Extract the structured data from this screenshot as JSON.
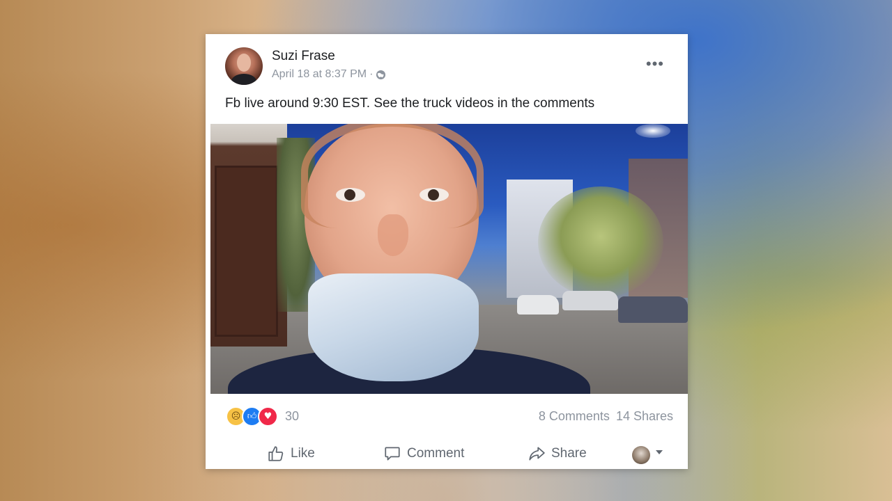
{
  "post": {
    "author": "Suzi Frase",
    "timestamp": "April 18 at 8:37 PM",
    "separator": "·",
    "privacy_icon": "globe-icon",
    "text": "Fb live around 9:30 EST. See the truck videos in the comments",
    "more_label": "•••"
  },
  "stats": {
    "reaction_icons": [
      "sad-reaction-icon",
      "like-reaction-icon",
      "love-reaction-icon"
    ],
    "reaction_count": "30",
    "comments": "8 Comments",
    "shares": "14 Shares"
  },
  "actions": {
    "like": "Like",
    "comment": "Comment",
    "share": "Share"
  },
  "colors": {
    "like_blue": "#1d7cf2",
    "love_red": "#f02849",
    "text_gray": "#8d949e",
    "action_gray": "#606770"
  }
}
